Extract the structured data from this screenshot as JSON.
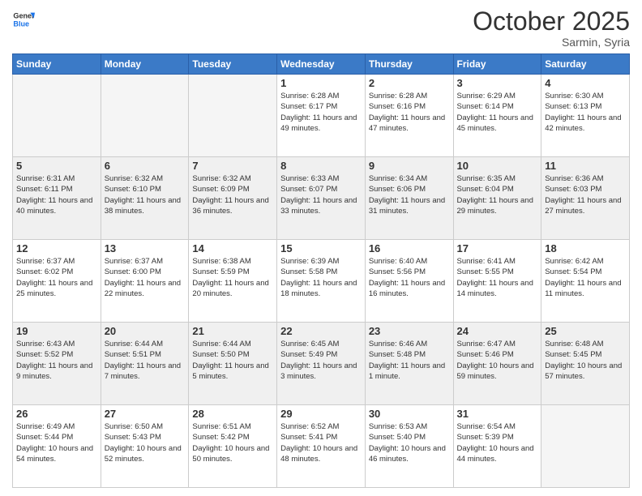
{
  "header": {
    "logo_general": "General",
    "logo_blue": "Blue",
    "month": "October 2025",
    "location": "Sarmin, Syria"
  },
  "weekdays": [
    "Sunday",
    "Monday",
    "Tuesday",
    "Wednesday",
    "Thursday",
    "Friday",
    "Saturday"
  ],
  "weeks": [
    [
      {
        "day": "",
        "sunrise": "",
        "sunset": "",
        "daylight": ""
      },
      {
        "day": "",
        "sunrise": "",
        "sunset": "",
        "daylight": ""
      },
      {
        "day": "",
        "sunrise": "",
        "sunset": "",
        "daylight": ""
      },
      {
        "day": "1",
        "sunrise": "Sunrise: 6:28 AM",
        "sunset": "Sunset: 6:17 PM",
        "daylight": "Daylight: 11 hours and 49 minutes."
      },
      {
        "day": "2",
        "sunrise": "Sunrise: 6:28 AM",
        "sunset": "Sunset: 6:16 PM",
        "daylight": "Daylight: 11 hours and 47 minutes."
      },
      {
        "day": "3",
        "sunrise": "Sunrise: 6:29 AM",
        "sunset": "Sunset: 6:14 PM",
        "daylight": "Daylight: 11 hours and 45 minutes."
      },
      {
        "day": "4",
        "sunrise": "Sunrise: 6:30 AM",
        "sunset": "Sunset: 6:13 PM",
        "daylight": "Daylight: 11 hours and 42 minutes."
      }
    ],
    [
      {
        "day": "5",
        "sunrise": "Sunrise: 6:31 AM",
        "sunset": "Sunset: 6:11 PM",
        "daylight": "Daylight: 11 hours and 40 minutes."
      },
      {
        "day": "6",
        "sunrise": "Sunrise: 6:32 AM",
        "sunset": "Sunset: 6:10 PM",
        "daylight": "Daylight: 11 hours and 38 minutes."
      },
      {
        "day": "7",
        "sunrise": "Sunrise: 6:32 AM",
        "sunset": "Sunset: 6:09 PM",
        "daylight": "Daylight: 11 hours and 36 minutes."
      },
      {
        "day": "8",
        "sunrise": "Sunrise: 6:33 AM",
        "sunset": "Sunset: 6:07 PM",
        "daylight": "Daylight: 11 hours and 33 minutes."
      },
      {
        "day": "9",
        "sunrise": "Sunrise: 6:34 AM",
        "sunset": "Sunset: 6:06 PM",
        "daylight": "Daylight: 11 hours and 31 minutes."
      },
      {
        "day": "10",
        "sunrise": "Sunrise: 6:35 AM",
        "sunset": "Sunset: 6:04 PM",
        "daylight": "Daylight: 11 hours and 29 minutes."
      },
      {
        "day": "11",
        "sunrise": "Sunrise: 6:36 AM",
        "sunset": "Sunset: 6:03 PM",
        "daylight": "Daylight: 11 hours and 27 minutes."
      }
    ],
    [
      {
        "day": "12",
        "sunrise": "Sunrise: 6:37 AM",
        "sunset": "Sunset: 6:02 PM",
        "daylight": "Daylight: 11 hours and 25 minutes."
      },
      {
        "day": "13",
        "sunrise": "Sunrise: 6:37 AM",
        "sunset": "Sunset: 6:00 PM",
        "daylight": "Daylight: 11 hours and 22 minutes."
      },
      {
        "day": "14",
        "sunrise": "Sunrise: 6:38 AM",
        "sunset": "Sunset: 5:59 PM",
        "daylight": "Daylight: 11 hours and 20 minutes."
      },
      {
        "day": "15",
        "sunrise": "Sunrise: 6:39 AM",
        "sunset": "Sunset: 5:58 PM",
        "daylight": "Daylight: 11 hours and 18 minutes."
      },
      {
        "day": "16",
        "sunrise": "Sunrise: 6:40 AM",
        "sunset": "Sunset: 5:56 PM",
        "daylight": "Daylight: 11 hours and 16 minutes."
      },
      {
        "day": "17",
        "sunrise": "Sunrise: 6:41 AM",
        "sunset": "Sunset: 5:55 PM",
        "daylight": "Daylight: 11 hours and 14 minutes."
      },
      {
        "day": "18",
        "sunrise": "Sunrise: 6:42 AM",
        "sunset": "Sunset: 5:54 PM",
        "daylight": "Daylight: 11 hours and 11 minutes."
      }
    ],
    [
      {
        "day": "19",
        "sunrise": "Sunrise: 6:43 AM",
        "sunset": "Sunset: 5:52 PM",
        "daylight": "Daylight: 11 hours and 9 minutes."
      },
      {
        "day": "20",
        "sunrise": "Sunrise: 6:44 AM",
        "sunset": "Sunset: 5:51 PM",
        "daylight": "Daylight: 11 hours and 7 minutes."
      },
      {
        "day": "21",
        "sunrise": "Sunrise: 6:44 AM",
        "sunset": "Sunset: 5:50 PM",
        "daylight": "Daylight: 11 hours and 5 minutes."
      },
      {
        "day": "22",
        "sunrise": "Sunrise: 6:45 AM",
        "sunset": "Sunset: 5:49 PM",
        "daylight": "Daylight: 11 hours and 3 minutes."
      },
      {
        "day": "23",
        "sunrise": "Sunrise: 6:46 AM",
        "sunset": "Sunset: 5:48 PM",
        "daylight": "Daylight: 11 hours and 1 minute."
      },
      {
        "day": "24",
        "sunrise": "Sunrise: 6:47 AM",
        "sunset": "Sunset: 5:46 PM",
        "daylight": "Daylight: 10 hours and 59 minutes."
      },
      {
        "day": "25",
        "sunrise": "Sunrise: 6:48 AM",
        "sunset": "Sunset: 5:45 PM",
        "daylight": "Daylight: 10 hours and 57 minutes."
      }
    ],
    [
      {
        "day": "26",
        "sunrise": "Sunrise: 6:49 AM",
        "sunset": "Sunset: 5:44 PM",
        "daylight": "Daylight: 10 hours and 54 minutes."
      },
      {
        "day": "27",
        "sunrise": "Sunrise: 6:50 AM",
        "sunset": "Sunset: 5:43 PM",
        "daylight": "Daylight: 10 hours and 52 minutes."
      },
      {
        "day": "28",
        "sunrise": "Sunrise: 6:51 AM",
        "sunset": "Sunset: 5:42 PM",
        "daylight": "Daylight: 10 hours and 50 minutes."
      },
      {
        "day": "29",
        "sunrise": "Sunrise: 6:52 AM",
        "sunset": "Sunset: 5:41 PM",
        "daylight": "Daylight: 10 hours and 48 minutes."
      },
      {
        "day": "30",
        "sunrise": "Sunrise: 6:53 AM",
        "sunset": "Sunset: 5:40 PM",
        "daylight": "Daylight: 10 hours and 46 minutes."
      },
      {
        "day": "31",
        "sunrise": "Sunrise: 6:54 AM",
        "sunset": "Sunset: 5:39 PM",
        "daylight": "Daylight: 10 hours and 44 minutes."
      },
      {
        "day": "",
        "sunrise": "",
        "sunset": "",
        "daylight": ""
      }
    ]
  ]
}
